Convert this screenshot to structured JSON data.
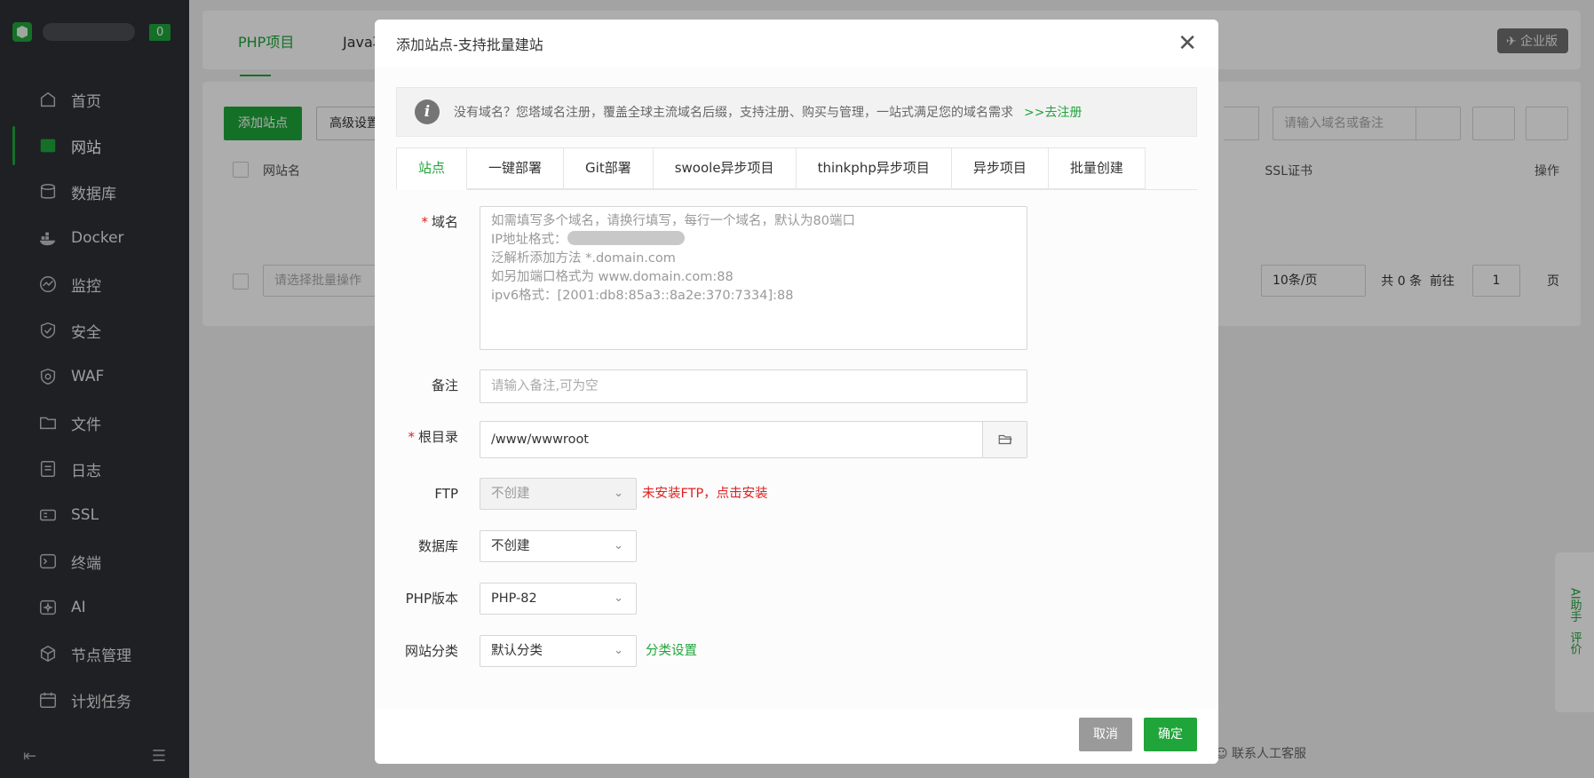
{
  "sidebar": {
    "badge": "0",
    "items": [
      {
        "label": "首页",
        "icon": "home-icon"
      },
      {
        "label": "网站",
        "icon": "website-icon",
        "active": true
      },
      {
        "label": "数据库",
        "icon": "database-icon"
      },
      {
        "label": "Docker",
        "icon": "docker-icon"
      },
      {
        "label": "监控",
        "icon": "monitor-icon"
      },
      {
        "label": "安全",
        "icon": "shield-icon"
      },
      {
        "label": "WAF",
        "icon": "waf-icon"
      },
      {
        "label": "文件",
        "icon": "folder-icon"
      },
      {
        "label": "日志",
        "icon": "log-icon"
      },
      {
        "label": "SSL",
        "icon": "ssl-icon"
      },
      {
        "label": "终端",
        "icon": "terminal-icon"
      },
      {
        "label": "AI",
        "icon": "ai-icon"
      },
      {
        "label": "节点管理",
        "icon": "node-icon"
      },
      {
        "label": "计划任务",
        "icon": "calendar-icon"
      }
    ]
  },
  "main": {
    "tabs": [
      "PHP项目",
      "Java项"
    ],
    "enterprise_label": "企业版",
    "add_site_label": "添加站点",
    "advanced_label": "高级设置",
    "search_placeholder": "请输入域名或备注",
    "col_name": "网站名",
    "col_ssl": "SSL证书",
    "col_ops": "操作",
    "batch_placeholder": "请选择批量操作",
    "page_size": "10条/页",
    "total": "共 0 条",
    "goto_label": "前往",
    "page_num": "1",
    "page_unit": "页",
    "service": "联系人工客服",
    "assist_ai": "AI助手",
    "assist_review": "评价"
  },
  "modal": {
    "title": "添加站点-支持批量建站",
    "notice": "没有域名？您塔域名注册，覆盖全球主流域名后缀，支持注册、购买与管理，一站式满足您的域名需求",
    "notice_link": ">>去注册",
    "tabs": [
      "站点",
      "一键部署",
      "Git部署",
      "swoole异步项目",
      "thinkphp异步项目",
      "异步项目",
      "批量创建"
    ],
    "domain_label": "域名",
    "domain_hint_1": "如需填写多个域名，请换行填写，每行一个域名，默认为80端口",
    "domain_hint_2": "IP地址格式：",
    "domain_hint_3": "泛解析添加方法 *.domain.com",
    "domain_hint_4": "如另加端口格式为 www.domain.com:88",
    "domain_hint_5": "ipv6格式：[2001:db8:85a3::8a2e:370:7334]:88",
    "remark_label": "备注",
    "remark_placeholder": "请输入备注,可为空",
    "root_label": "根目录",
    "root_value": "/www/wwwroot",
    "ftp_label": "FTP",
    "ftp_value": "不创建",
    "ftp_note": "未安装FTP，点击安装",
    "db_label": "数据库",
    "db_value": "不创建",
    "php_label": "PHP版本",
    "php_value": "PHP-82",
    "category_label": "网站分类",
    "category_value": "默认分类",
    "category_link": "分类设置",
    "cancel_label": "取消",
    "confirm_label": "确定"
  },
  "colors": {
    "accent": "#20a53a",
    "danger": "#e02020",
    "sidebar_bg": "#2d3035"
  }
}
